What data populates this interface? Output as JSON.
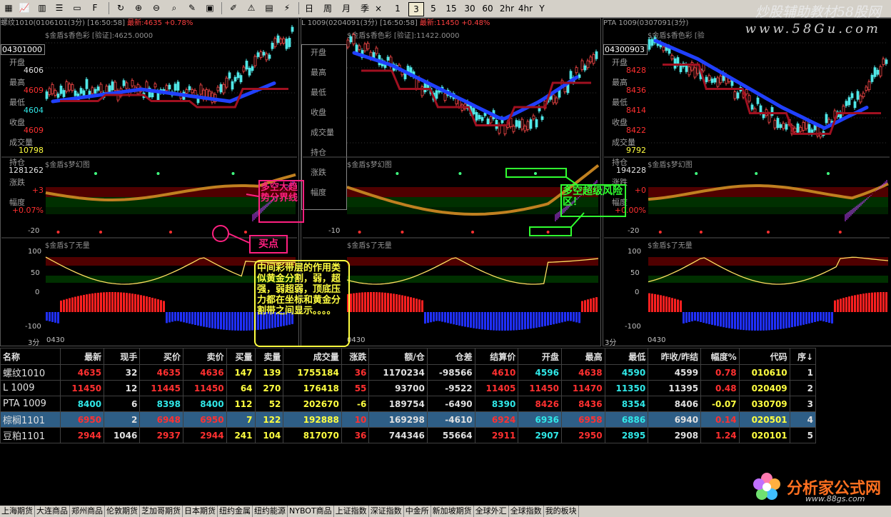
{
  "toolbar": {
    "periods": [
      "日",
      "周",
      "月",
      "季",
      "1",
      "3",
      "5",
      "15",
      "30",
      "60",
      "2hr",
      "4hr",
      "Y"
    ],
    "selected_period": "3",
    "x_label": "×"
  },
  "watermark": {
    "line1": "炒股辅助教材58股网",
    "line2": "www.58Gu.com"
  },
  "panels": [
    {
      "title_sym": "螺纹1010(0106101(3分)",
      "title_time": "[16:50:58]",
      "title_price": "最新:4635",
      "title_chg": "+0.78%",
      "sub_title1": "$金盾$香色彩 [验证]:4625.0000",
      "sub_title2": "$金盾$梦幻图",
      "sub_title3": "$金盾$了无量",
      "info": {
        "code": "04301000",
        "rows": [
          {
            "label": "开盘",
            "value": "4606",
            "color": "white"
          },
          {
            "label": "最高",
            "value": "4609",
            "color": "red"
          },
          {
            "label": "最低",
            "value": "4604",
            "color": "cyan"
          },
          {
            "label": "收盘",
            "value": "4609",
            "color": "red"
          },
          {
            "label": "成交量",
            "value": "10798",
            "color": "yellow"
          },
          {
            "label": "持仓",
            "value": "1281262",
            "color": "white"
          },
          {
            "label": "涨跌",
            "value": "+3",
            "color": "red"
          },
          {
            "label": "幅度",
            "value": "+0.07%",
            "color": "red"
          }
        ]
      },
      "axis1": "-20",
      "axis2": [
        "100",
        "50",
        "0",
        "-100"
      ],
      "bottom_label": "3分",
      "bottom_time": "0430"
    },
    {
      "title_sym": "L 1009(0204091(3分)",
      "title_time": "[16:50:58]",
      "title_price": "最新:11450",
      "title_chg": "+0.48%",
      "sub_title1": "$金盾$香色彩 [验证]:11422.0000",
      "sub_title2": "$金盾$梦幻图",
      "sub_title3": "$金盾$了无量",
      "info": {
        "code": "",
        "rows": [
          {
            "label": "开盘",
            "value": "",
            "color": "white"
          },
          {
            "label": "最高",
            "value": "",
            "color": "red"
          },
          {
            "label": "最低",
            "value": "",
            "color": "cyan"
          },
          {
            "label": "收盘",
            "value": "",
            "color": "red"
          },
          {
            "label": "成交量",
            "value": "",
            "color": "yellow"
          },
          {
            "label": "持仓",
            "value": "",
            "color": "white"
          },
          {
            "label": "涨跌",
            "value": "",
            "color": "red"
          },
          {
            "label": "幅度",
            "value": "",
            "color": "red"
          }
        ]
      },
      "axis1": "-10",
      "axis2": [
        "",
        "",
        "",
        ""
      ],
      "bottom_label": "",
      "bottom_time": "0430"
    },
    {
      "title_sym": "PTA 1009(0307091(3分)",
      "title_time": "",
      "title_price": "",
      "title_chg": "",
      "sub_title1": "$金盾$香色彩 [验",
      "sub_title2": "$金盾$梦幻图",
      "sub_title3": "$金盾$了无量",
      "info": {
        "code": "04300903",
        "rows": [
          {
            "label": "开盘",
            "value": "8428",
            "color": "red"
          },
          {
            "label": "最高",
            "value": "8436",
            "color": "red"
          },
          {
            "label": "最低",
            "value": "8414",
            "color": "red"
          },
          {
            "label": "收盘",
            "value": "8422",
            "color": "red"
          },
          {
            "label": "成交量",
            "value": "9792",
            "color": "yellow"
          },
          {
            "label": "持仓",
            "value": "194228",
            "color": "white"
          },
          {
            "label": "涨跌",
            "value": "+0",
            "color": "red"
          },
          {
            "label": "幅度",
            "value": "+0.00%",
            "color": "red"
          }
        ]
      },
      "axis1": "-20",
      "axis2": [
        "100",
        "50",
        "0",
        "-100"
      ],
      "bottom_label": "3分",
      "bottom_time": "0430"
    }
  ],
  "annotations": {
    "a1": "多空大趋势分界线",
    "a2": "买点",
    "a3": "多空超级风险区！",
    "a4": "中间彩带层的作用类似黄金分割，弱，超强，弱超弱，顶底压力都在坐标和黄金分割带之间显示。。。。"
  },
  "table": {
    "headers": [
      "名称",
      "最新",
      "现手",
      "买价",
      "卖价",
      "买量",
      "卖量",
      "成交量",
      "涨跌",
      "额/仓",
      "仓差",
      "结算价",
      "开盘",
      "最高",
      "最低",
      "昨收/昨结",
      "幅度%",
      "代码",
      "序↓"
    ],
    "rows": [
      {
        "cells": [
          "螺纹1010",
          "4635",
          "32",
          "4635",
          "4636",
          "147",
          "139",
          "1755184",
          "36",
          "1170234",
          "-98566",
          "4610",
          "4596",
          "4638",
          "4590",
          "4599",
          "0.78",
          "010610",
          "1"
        ]
      },
      {
        "cells": [
          "L   1009",
          "11450",
          "12",
          "11445",
          "11450",
          "64",
          "270",
          "176418",
          "55",
          "93700",
          "-9522",
          "11405",
          "11450",
          "11470",
          "11350",
          "11395",
          "0.48",
          "020409",
          "2"
        ]
      },
      {
        "cells": [
          "PTA 1009",
          "8400",
          "6",
          "8398",
          "8400",
          "112",
          "52",
          "202670",
          "-6",
          "189754",
          "-6490",
          "8390",
          "8426",
          "8436",
          "8354",
          "8406",
          "-0.07",
          "030709",
          "3"
        ]
      },
      {
        "cells": [
          "棕榈1101",
          "6950",
          "2",
          "6948",
          "6950",
          "7",
          "122",
          "192888",
          "10",
          "169298",
          "-4610",
          "6924",
          "6936",
          "6958",
          "6886",
          "6940",
          "0.14",
          "020501",
          "4"
        ]
      },
      {
        "cells": [
          "豆粕1101",
          "2944",
          "1046",
          "2937",
          "2944",
          "241",
          "104",
          "817070",
          "36",
          "744346",
          "55664",
          "2911",
          "2907",
          "2950",
          "2895",
          "2908",
          "1.24",
          "020101",
          "5"
        ]
      }
    ]
  },
  "tabs": [
    "上海期货",
    "大连商品",
    "郑州商品",
    "伦敦期货",
    "芝加哥期货",
    "日本期货",
    "纽约金属",
    "纽约能源",
    "NYBOT商品",
    "上证指数",
    "深证指数",
    "中金所",
    "新加坡期货",
    "全球外汇",
    "全球指数",
    "我的板块"
  ],
  "logo": {
    "text": "分析家公式网",
    "url": "www.88gs.com"
  }
}
